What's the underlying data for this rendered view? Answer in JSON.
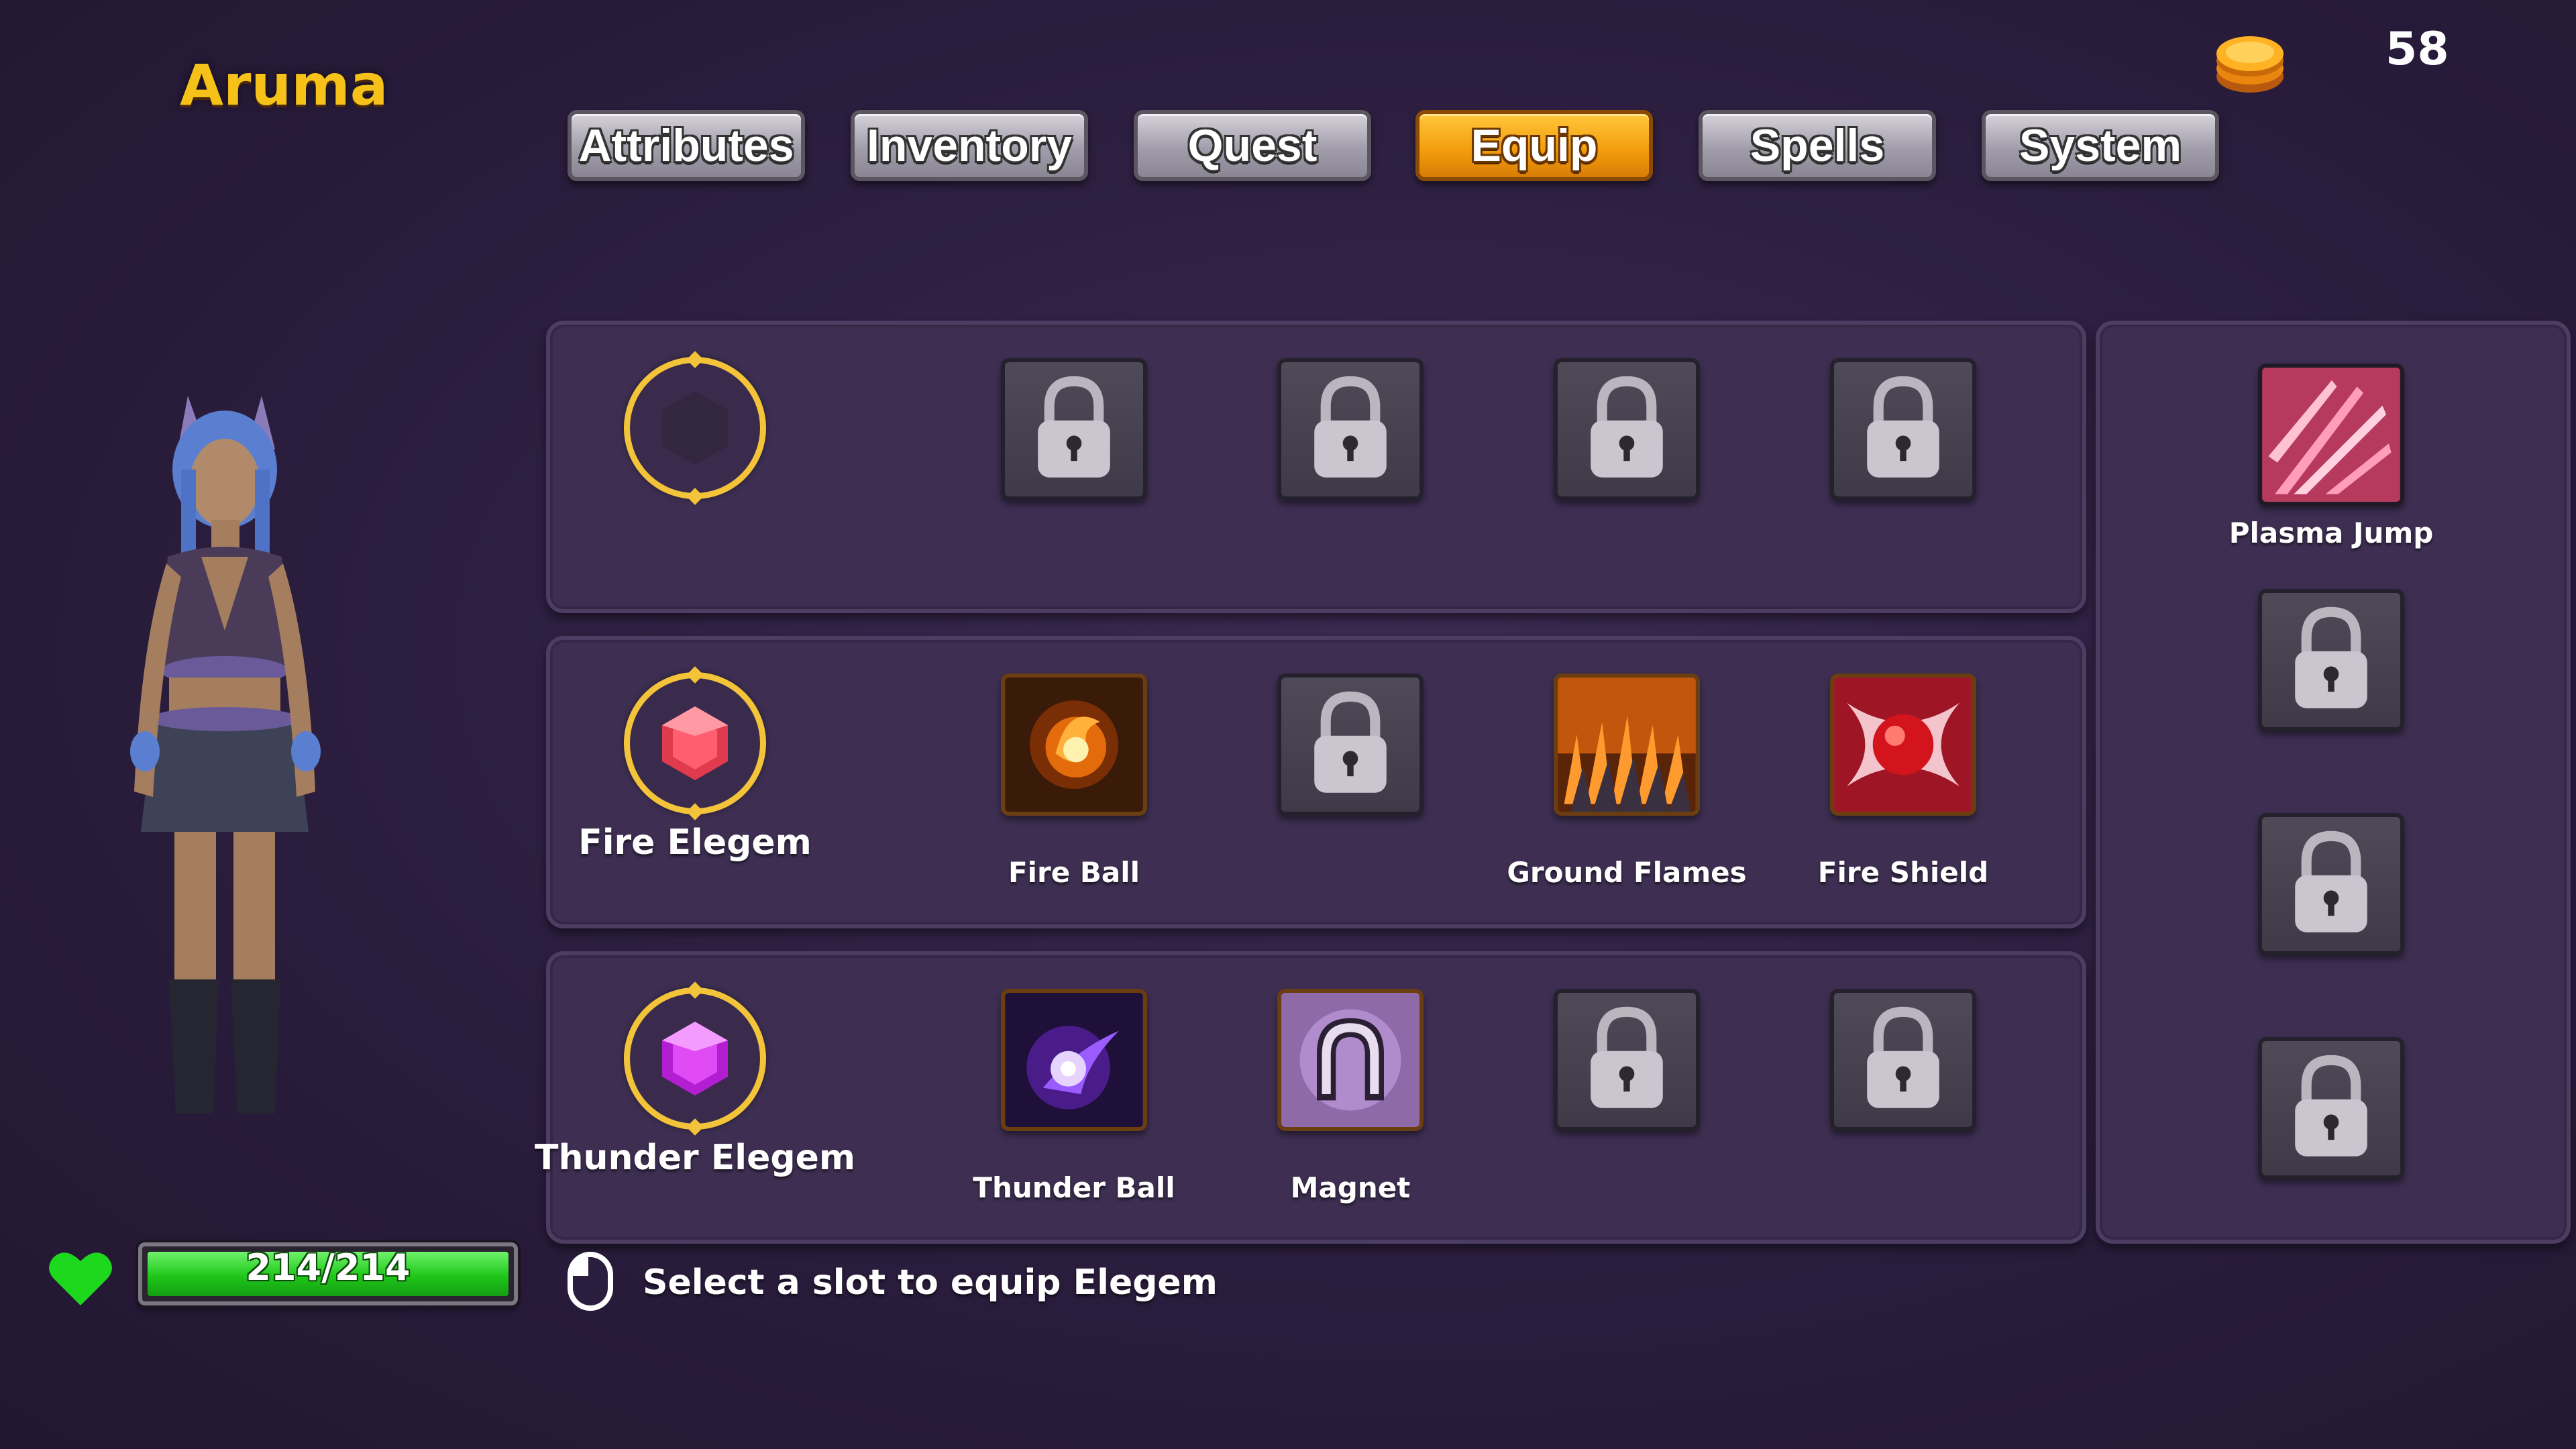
{
  "player": {
    "name": "Aruma",
    "coins": "58",
    "hp_text": "214/214",
    "hp_fraction": 1.0
  },
  "tabs": [
    {
      "label": "Attributes",
      "active": false
    },
    {
      "label": "Inventory",
      "active": false
    },
    {
      "label": "Quest",
      "active": false
    },
    {
      "label": "Equip",
      "active": true
    },
    {
      "label": "Spells",
      "active": false
    },
    {
      "label": "System",
      "active": false
    }
  ],
  "rows": [
    {
      "gem_label": "",
      "gem": "empty-gem",
      "slots": [
        {
          "state": "locked",
          "icon": "lock-icon",
          "label": ""
        },
        {
          "state": "locked",
          "icon": "lock-icon",
          "label": ""
        },
        {
          "state": "locked",
          "icon": "lock-icon",
          "label": ""
        },
        {
          "state": "locked",
          "icon": "lock-icon",
          "label": ""
        }
      ]
    },
    {
      "gem_label": "Fire Elegem",
      "gem": "fire-gem-icon",
      "slots": [
        {
          "state": "ability",
          "icon": "fire-ball-icon",
          "label": "Fire Ball"
        },
        {
          "state": "locked",
          "icon": "lock-icon",
          "label": ""
        },
        {
          "state": "ability",
          "icon": "ground-flames-icon",
          "label": "Ground Flames"
        },
        {
          "state": "ability",
          "icon": "fire-shield-icon",
          "label": "Fire Shield"
        }
      ]
    },
    {
      "gem_label": "Thunder Elegem",
      "gem": "thunder-gem-icon",
      "slots": [
        {
          "state": "ability",
          "icon": "thunder-ball-icon",
          "label": "Thunder Ball"
        },
        {
          "state": "ability",
          "icon": "magnet-icon",
          "label": "Magnet"
        },
        {
          "state": "locked",
          "icon": "lock-icon",
          "label": ""
        },
        {
          "state": "locked",
          "icon": "lock-icon",
          "label": ""
        }
      ]
    }
  ],
  "side_slots": [
    {
      "state": "ability",
      "icon": "plasma-jump-icon",
      "label": "Plasma Jump"
    },
    {
      "state": "locked",
      "icon": "lock-icon",
      "label": ""
    },
    {
      "state": "locked",
      "icon": "lock-icon",
      "label": ""
    },
    {
      "state": "locked",
      "icon": "lock-icon",
      "label": ""
    }
  ],
  "hint": {
    "icon": "mouse-icon",
    "text": "Select a slot to equip Elegem"
  },
  "colors": {
    "accent": "#f6c21a",
    "tab_active": "#f29a0c",
    "hp": "#1fc71a",
    "panel": "#3e2f52"
  }
}
